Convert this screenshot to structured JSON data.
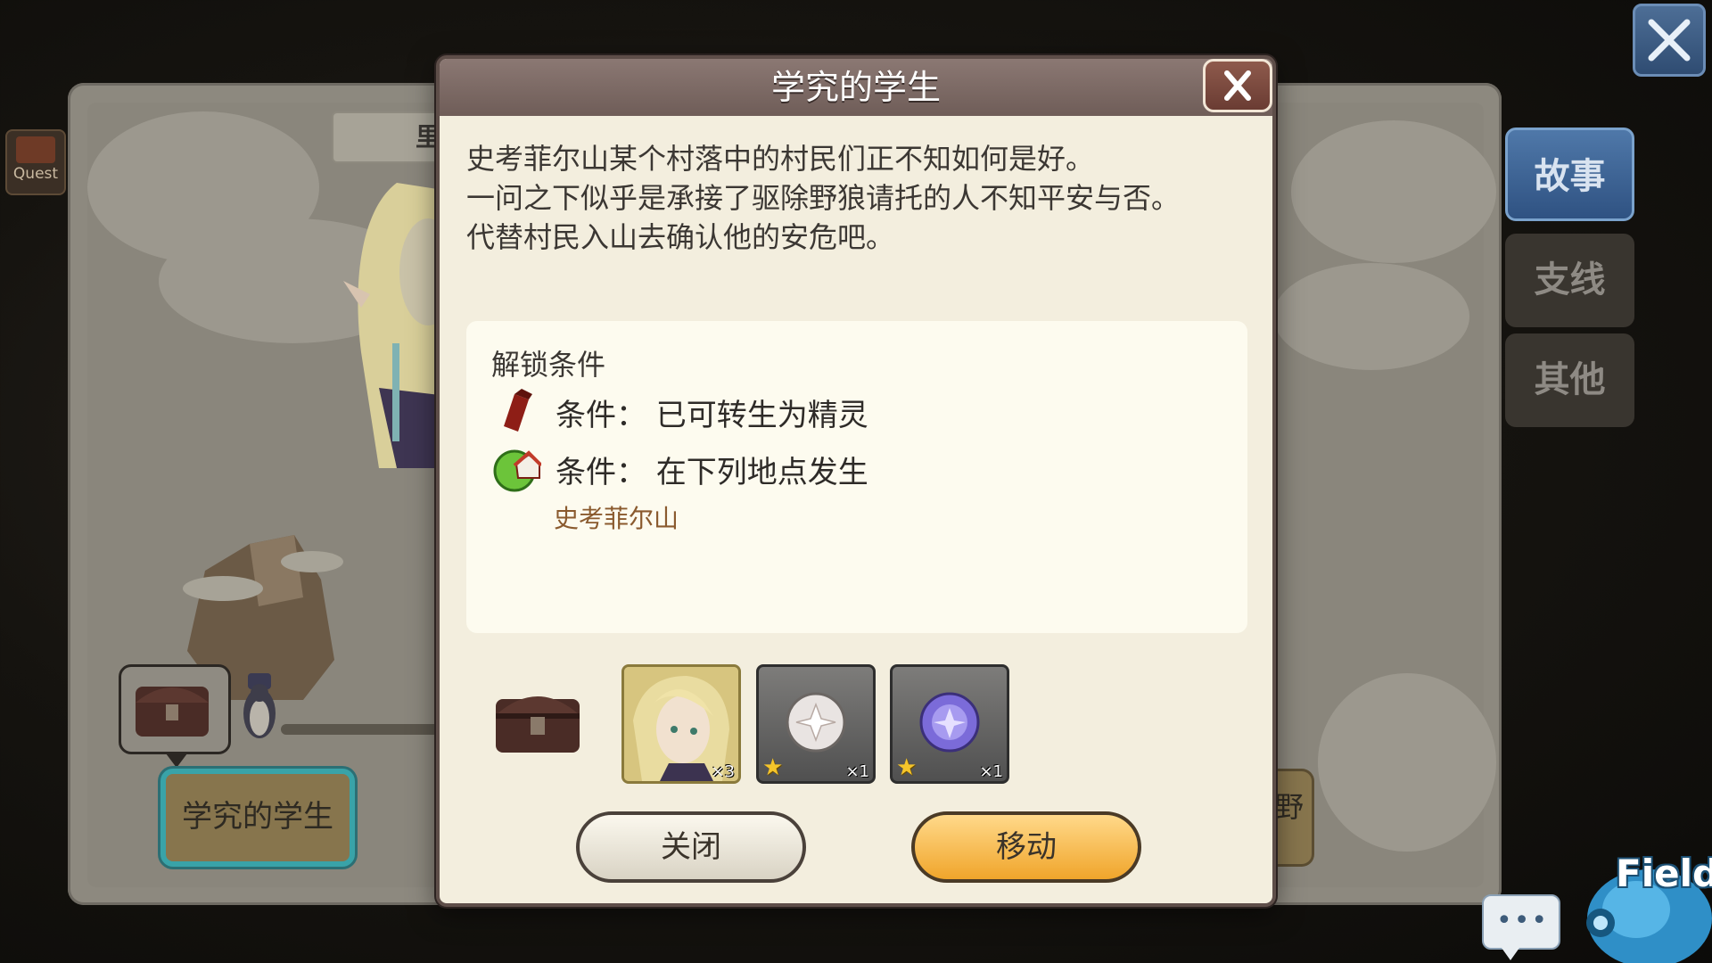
{
  "hud": {
    "quest_label": "Quest",
    "field_label": "Field",
    "chat_dots": "•••"
  },
  "map": {
    "top_tab_label": "里",
    "node_label": "学究的学生",
    "right_node_partial": "野"
  },
  "side_tabs": [
    {
      "label": "故事",
      "active": true
    },
    {
      "label": "支线",
      "active": false
    },
    {
      "label": "其他",
      "active": false
    }
  ],
  "dialog": {
    "title": "学究的学生",
    "description": [
      "史考菲尔山某个村落中的村民们正不知如何是好。",
      "一问之下似乎是承接了驱除野狼请托的人不知平安与否。",
      "代替村民入山去确认他的安危吧。"
    ],
    "unlock": {
      "heading": "解锁条件",
      "conditions": [
        {
          "icon": "book-icon",
          "text": "条件：  已可转生为精灵"
        },
        {
          "icon": "location-icon",
          "text": "条件：  在下列地点发生"
        }
      ],
      "location": "史考菲尔山"
    },
    "rewards": [
      {
        "icon": "elf-portrait",
        "qty": "×3"
      },
      {
        "icon": "white-orb-icon",
        "qty": "×1",
        "stars": 1
      },
      {
        "icon": "purple-orb-icon",
        "qty": "×1",
        "stars": 1
      }
    ],
    "close_button": "关闭",
    "move_button": "移动"
  },
  "colors": {
    "accent_tab": "#2f5282",
    "move_button": "#f0a52b",
    "location_text": "#8a5a2e",
    "node_border": "#39a3a8"
  }
}
